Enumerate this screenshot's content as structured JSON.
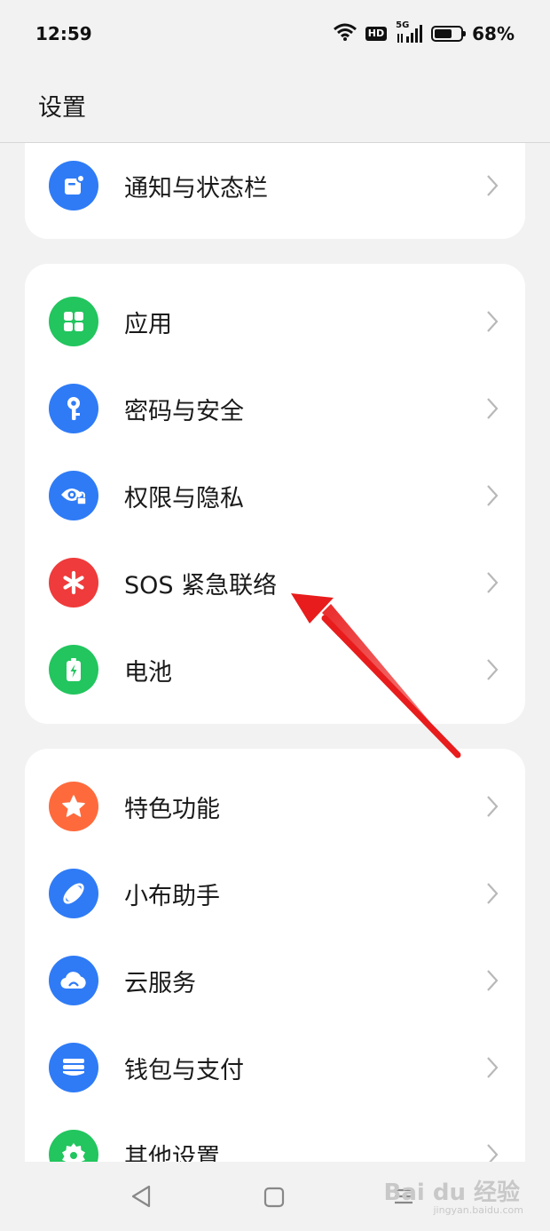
{
  "status_bar": {
    "time": "12:59",
    "network": "5G",
    "hd": "HD",
    "battery_percent": "68%",
    "battery_level": 0.68
  },
  "header": {
    "title": "设置"
  },
  "groups": [
    {
      "items": [
        {
          "label": "通知与状态栏",
          "icon": "notification-icon",
          "color": "#2f7bf6"
        }
      ]
    },
    {
      "items": [
        {
          "label": "应用",
          "icon": "apps-grid-icon",
          "color": "#22c55e"
        },
        {
          "label": "密码与安全",
          "icon": "key-icon",
          "color": "#2f7bf6"
        },
        {
          "label": "权限与隐私",
          "icon": "privacy-eye-icon",
          "color": "#2f7bf6"
        },
        {
          "label": "SOS 紧急联络",
          "icon": "sos-asterisk-icon",
          "color": "#ef3b3b"
        },
        {
          "label": "电池",
          "icon": "battery-icon",
          "color": "#22c55e"
        }
      ]
    },
    {
      "items": [
        {
          "label": "特色功能",
          "icon": "star-icon",
          "color": "#ff6a3d"
        },
        {
          "label": "小布助手",
          "icon": "assistant-orbit-icon",
          "color": "#2f7bf6"
        },
        {
          "label": "云服务",
          "icon": "cloud-icon",
          "color": "#2f7bf6"
        },
        {
          "label": "钱包与支付",
          "icon": "wallet-icon",
          "color": "#2f7bf6"
        },
        {
          "label": "其他设置",
          "icon": "gear-icon",
          "color": "#22c55e"
        }
      ]
    }
  ],
  "annotation": {
    "arrow_color": "#e81c1c"
  },
  "watermark": {
    "text": "Bai du 经验",
    "sub": "jingyan.baidu.com"
  }
}
